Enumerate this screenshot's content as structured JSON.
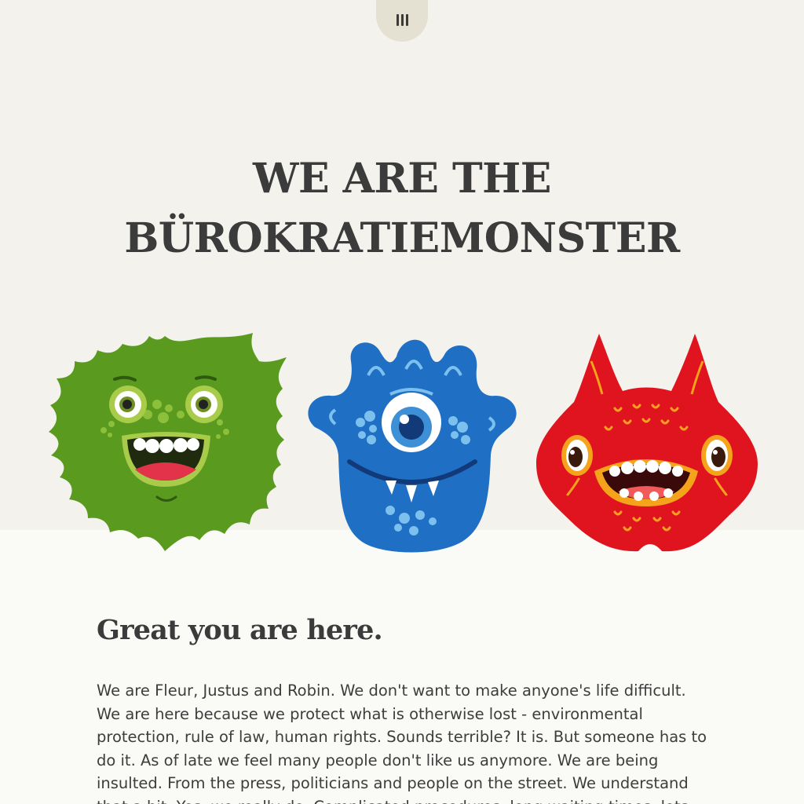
{
  "header": {
    "menu_icon": "menu-bars-icon"
  },
  "hero": {
    "title_line1": "WE ARE THE",
    "title_line2": "BÜROKRATIEMONSTER",
    "background": "#f3f2ec",
    "monsters": [
      {
        "name": "green-monster",
        "color": "#5a9a1f"
      },
      {
        "name": "blue-monster",
        "color": "#1f6fc4"
      },
      {
        "name": "red-monster",
        "color": "#e0141f"
      }
    ]
  },
  "main": {
    "heading": "Great you are here.",
    "intro": "We are Fleur, Justus and Robin. We don't want to make anyone's life difficult. We are here because we protect what is otherwise lost - environmental protection, rule of law, human rights. Sounds terrible? It is. But someone has to do it. As of late we feel many people don't like us anymore. We are being insulted. From the press, politicians and people on the street. We understand that a bit. Yes, we really do. Complicated procedures, long waiting times, lots"
  }
}
